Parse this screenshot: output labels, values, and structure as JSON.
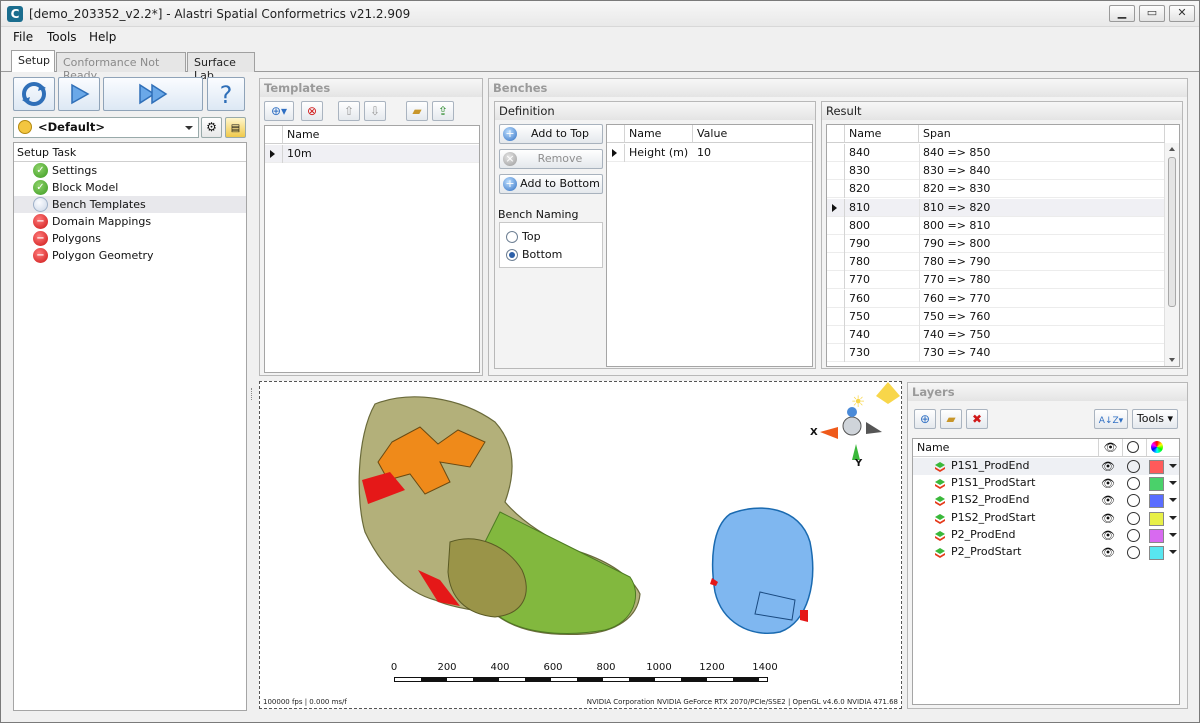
{
  "window": {
    "title": "[demo_203352_v2.2*] - Alastri Spatial Conformetrics v21.2.909"
  },
  "menu": [
    "File",
    "Tools",
    "Help"
  ],
  "tabs": [
    {
      "label": "Setup",
      "state": "active"
    },
    {
      "label": "Conformance Not Ready",
      "state": "disabled"
    },
    {
      "label": "Surface Lab",
      "state": "normal"
    }
  ],
  "setup": {
    "preset": "<Default>",
    "task_header": "Setup Task",
    "tasks": [
      {
        "label": "Settings",
        "status": "ok"
      },
      {
        "label": "Block Model",
        "status": "ok"
      },
      {
        "label": "Bench Templates",
        "status": "pending",
        "selected": true
      },
      {
        "label": "Domain Mappings",
        "status": "error"
      },
      {
        "label": "Polygons",
        "status": "error"
      },
      {
        "label": "Polygon Geometry",
        "status": "error"
      }
    ]
  },
  "templates": {
    "title": "Templates",
    "column": "Name",
    "rows": [
      "10m"
    ]
  },
  "benches": {
    "title": "Benches",
    "definition": {
      "title": "Definition",
      "add_top": "Add to Top",
      "remove": "Remove",
      "add_bottom": "Add to Bottom",
      "naming_label": "Bench Naming",
      "naming_options": [
        "Top",
        "Bottom"
      ],
      "naming_selected": "Bottom",
      "columns": [
        "Name",
        "Value"
      ],
      "rows": [
        {
          "name": "Height (m)",
          "value": "10"
        }
      ]
    },
    "result": {
      "title": "Result",
      "columns": [
        "Name",
        "Span"
      ],
      "selected": "810",
      "rows": [
        {
          "name": "840",
          "span": "840 => 850"
        },
        {
          "name": "830",
          "span": "830 => 840"
        },
        {
          "name": "820",
          "span": "820 => 830"
        },
        {
          "name": "810",
          "span": "810 => 820"
        },
        {
          "name": "800",
          "span": "800 => 810"
        },
        {
          "name": "790",
          "span": "790 => 800"
        },
        {
          "name": "780",
          "span": "780 => 790"
        },
        {
          "name": "770",
          "span": "770 => 780"
        },
        {
          "name": "760",
          "span": "760 => 770"
        },
        {
          "name": "750",
          "span": "750 => 760"
        },
        {
          "name": "740",
          "span": "740 => 750"
        },
        {
          "name": "730",
          "span": "730 => 740"
        }
      ]
    }
  },
  "viewport": {
    "scale_ticks": [
      "0",
      "200",
      "400",
      "600",
      "800",
      "1000",
      "1200",
      "1400"
    ],
    "footer_left": "100000 fps | 0.000 ms/f",
    "footer_right": "NVIDIA Corporation NVIDIA GeForce RTX 2070/PCIe/SSE2 | OpenGL v4.6.0 NVIDIA 471.68",
    "axis_x": "X",
    "axis_y": "Y"
  },
  "layers": {
    "title": "Layers",
    "tools_label": "Tools",
    "column": "Name",
    "items": [
      {
        "name": "P1S1_ProdEnd",
        "color": "#ff5a5a"
      },
      {
        "name": "P1S1_ProdStart",
        "color": "#4ad16a"
      },
      {
        "name": "P1S2_ProdEnd",
        "color": "#5a6dff"
      },
      {
        "name": "P1S2_ProdStart",
        "color": "#e8f046"
      },
      {
        "name": "P2_ProdEnd",
        "color": "#d86af0"
      },
      {
        "name": "P2_ProdStart",
        "color": "#58e6f0"
      }
    ]
  }
}
